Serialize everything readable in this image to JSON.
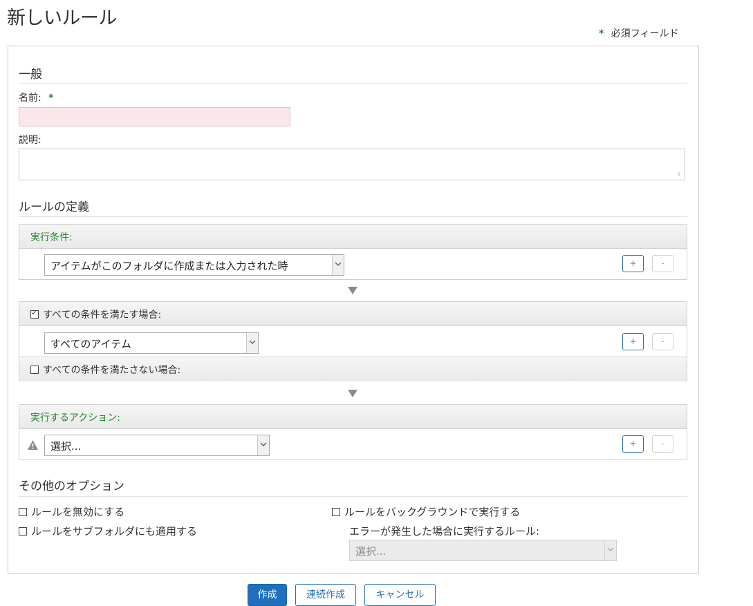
{
  "page": {
    "title": "新しいルール",
    "required_note": "必須フィールド",
    "required_mark": "*"
  },
  "general": {
    "heading": "一般",
    "name_label": "名前:",
    "name_value": "",
    "description_label": "説明:",
    "description_value": ""
  },
  "rule_definition": {
    "heading": "ルールの定義",
    "trigger": {
      "header": "実行条件:",
      "select_value": "アイテムがこのフォルダに作成または入力された時",
      "add_label": "+",
      "remove_label": "-"
    },
    "conditions_all": {
      "header": "すべての条件を満たす場合:",
      "checked": true,
      "select_value": "すべてのアイテム",
      "add_label": "+",
      "remove_label": "-"
    },
    "conditions_none": {
      "header": "すべての条件を満たさない場合:",
      "checked": false
    },
    "actions": {
      "header": "実行するアクション:",
      "select_value": "選択...",
      "add_label": "+",
      "remove_label": "-"
    }
  },
  "other_options": {
    "heading": "その他のオプション",
    "disable_rule": "ルールを無効にする",
    "apply_subfolders": "ルールをサブフォルダにも適用する",
    "run_background": "ルールをバックグラウンドで実行する",
    "error_rule_label": "エラーが発生した場合に実行するルール:",
    "error_rule_select": "選択..."
  },
  "footer": {
    "create": "作成",
    "create_continue": "連続作成",
    "cancel": "キャンセル"
  },
  "colors": {
    "accent": "#1f70bd",
    "required": "#1e8a2b",
    "invalid_field": "#fbe7e8"
  }
}
